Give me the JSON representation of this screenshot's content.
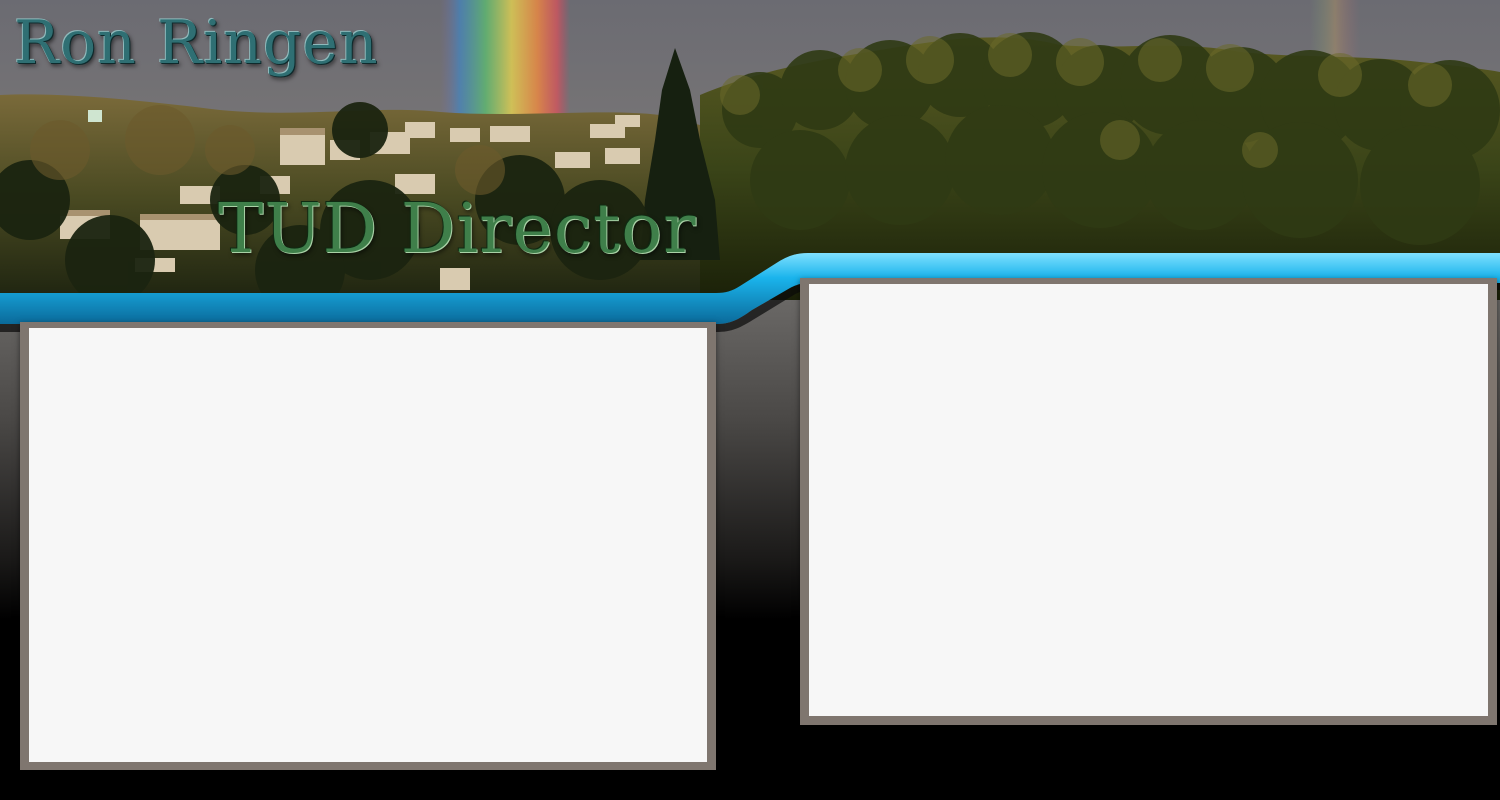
{
  "header": {
    "site_name": "Ron Ringen",
    "subtitle": "TUD Director",
    "image_alt": "Hillside with houses, pine forest and a rainbow"
  },
  "colors": {
    "accent_blue": "#1ab4ec",
    "panel_frame": "#7f766f",
    "panel_fill": "#f7f7f7",
    "title_teal": "#2f6f73",
    "subtitle_green": "#3f7f4a"
  },
  "panels": {
    "left": {
      "content": ""
    },
    "right": {
      "content": ""
    }
  }
}
